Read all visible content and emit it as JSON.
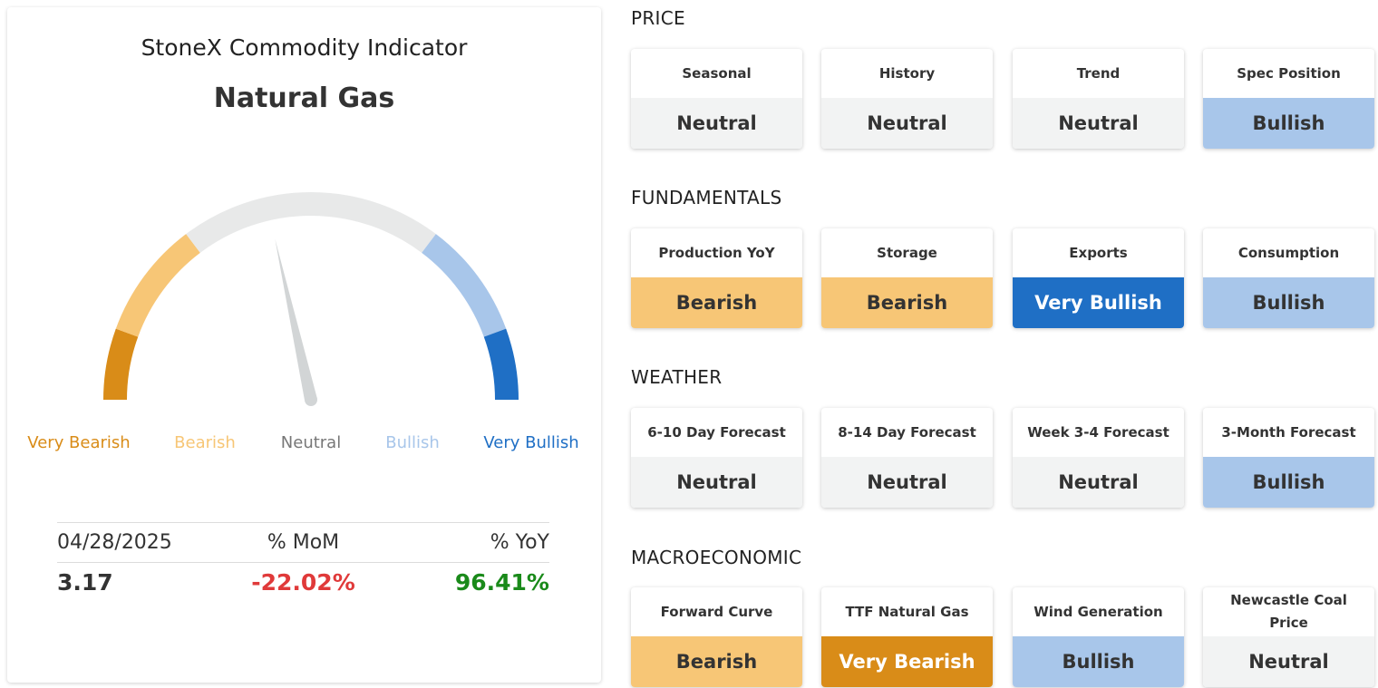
{
  "indicator": {
    "title": "StoneX Commodity Indicator",
    "commodity": "Natural Gas",
    "gauge": {
      "value_fraction": 0.43,
      "labels": [
        {
          "text": "Very Bearish",
          "color": "#d98c18"
        },
        {
          "text": "Bearish",
          "color": "#f7c676"
        },
        {
          "text": "Neutral",
          "color": "#777777"
        },
        {
          "text": "Bullish",
          "color": "#a8c6ea"
        },
        {
          "text": "Very Bullish",
          "color": "#1f6fc5"
        }
      ],
      "segment_colors": [
        "#d98c18",
        "#f7c676",
        "#e8e9e9",
        "#a8c6ea",
        "#1f6fc5"
      ],
      "needle_color": "#d2d5d6"
    },
    "stats": {
      "date": "04/28/2025",
      "mom_label": "% MoM",
      "yoy_label": "% YoY",
      "price": "3.17",
      "mom_value": "-22.02%",
      "yoy_value": "96.41%"
    }
  },
  "sections": [
    {
      "title": "PRICE",
      "tiles": [
        {
          "label": "Seasonal",
          "value": "Neutral",
          "status": "neutral"
        },
        {
          "label": "History",
          "value": "Neutral",
          "status": "neutral"
        },
        {
          "label": "Trend",
          "value": "Neutral",
          "status": "neutral"
        },
        {
          "label": "Spec Position",
          "value": "Bullish",
          "status": "bullish"
        }
      ]
    },
    {
      "title": "FUNDAMENTALS",
      "tiles": [
        {
          "label": "Production YoY",
          "value": "Bearish",
          "status": "bearish"
        },
        {
          "label": "Storage",
          "value": "Bearish",
          "status": "bearish"
        },
        {
          "label": "Exports",
          "value": "Very Bullish",
          "status": "verybullish"
        },
        {
          "label": "Consumption",
          "value": "Bullish",
          "status": "bullish"
        }
      ]
    },
    {
      "title": "WEATHER",
      "tiles": [
        {
          "label": "6-10 Day Forecast",
          "value": "Neutral",
          "status": "neutral"
        },
        {
          "label": "8-14 Day Forecast",
          "value": "Neutral",
          "status": "neutral"
        },
        {
          "label": "Week 3-4 Forecast",
          "value": "Neutral",
          "status": "neutral"
        },
        {
          "label": "3-Month Forecast",
          "value": "Bullish",
          "status": "bullish"
        }
      ]
    },
    {
      "title": "MACROECONOMIC",
      "tiles": [
        {
          "label": "Forward Curve",
          "value": "Bearish",
          "status": "bearish"
        },
        {
          "label": "TTF Natural Gas",
          "value": "Very Bearish",
          "status": "verybearish"
        },
        {
          "label": "Wind Generation",
          "value": "Bullish",
          "status": "bullish"
        },
        {
          "label": "Newcastle Coal Price",
          "value": "Neutral",
          "status": "neutral"
        }
      ]
    }
  ]
}
